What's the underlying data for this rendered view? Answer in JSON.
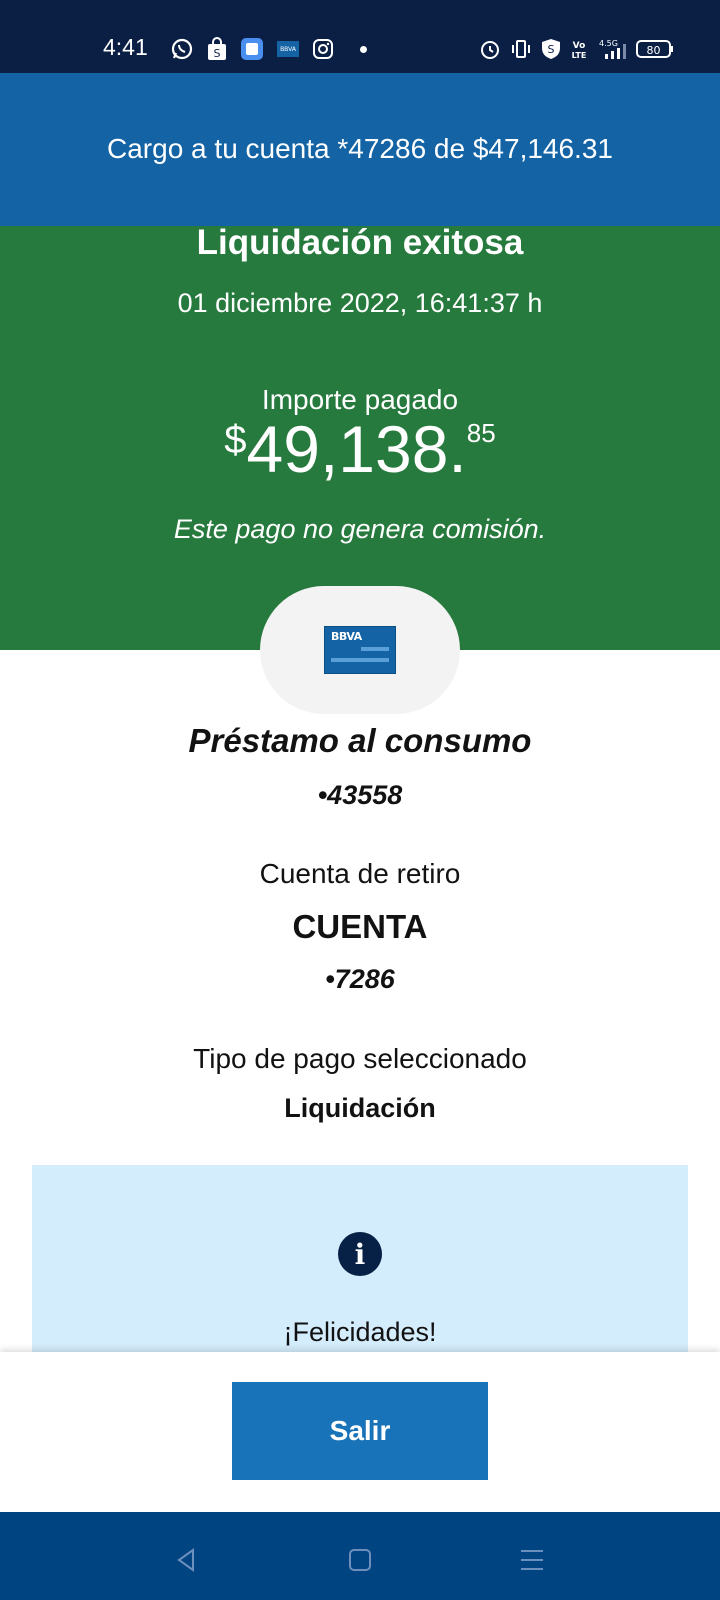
{
  "status_bar": {
    "time": "4:41",
    "network": "4.5G",
    "volte": "Vo LTE",
    "battery": "80",
    "left_icons": [
      "whatsapp-icon",
      "shopping-bag-icon",
      "app-icon",
      "bbva-icon",
      "instagram-icon",
      "dot-icon"
    ],
    "right_icons": [
      "alarm-icon",
      "vibrate-icon",
      "shield-icon",
      "volte-icon",
      "signal-icon",
      "battery-icon"
    ]
  },
  "toast": {
    "message": "Cargo a tu cuenta *47286 de $47,146.31"
  },
  "hero": {
    "title": "Liquidación exitosa",
    "datetime": "01 diciembre 2022, 16:41:37 h",
    "amount_label": "Importe pagado",
    "amount_symbol": "$",
    "amount_integer": "49,138.",
    "amount_decimals": "85",
    "commission_note": "Este pago no genera comisión."
  },
  "card": {
    "brand": "BBVA"
  },
  "details": {
    "product_name": "Préstamo al consumo",
    "product_number": "•43558",
    "account_label": "Cuenta de retiro",
    "account_name": "CUENTA",
    "account_number": "•7286",
    "payment_type_label": "Tipo de pago seleccionado",
    "payment_type_value": "Liquidación"
  },
  "info": {
    "icon": "info-icon",
    "title": "¡Felicidades!"
  },
  "actions": {
    "exit_label": "Salir"
  },
  "colors": {
    "status_bar": "#0b1f45",
    "toast": "#1464a5",
    "hero": "#277a3e",
    "info_box": "#d4edfc",
    "button": "#1973b8",
    "nav_bar": "#004481"
  }
}
